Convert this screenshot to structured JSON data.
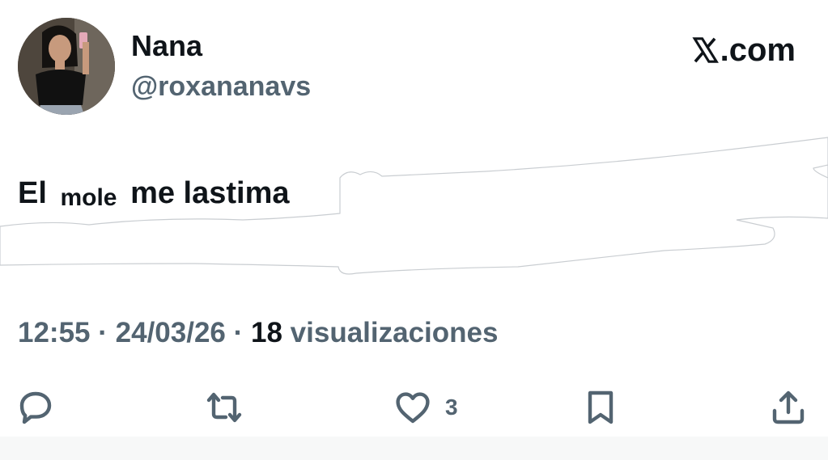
{
  "user": {
    "name": "Nana",
    "handle": "@roxananavs"
  },
  "brand": {
    "logo_icon": "x-logo-icon",
    "label": ".com"
  },
  "tweet": {
    "part1": "El",
    "part2": "mole",
    "part3": "me lastima"
  },
  "meta": {
    "time": "12:55",
    "sep1": " · ",
    "date": "24/03/26",
    "sep2": " · ",
    "views_count": "18",
    "views_label": " visualizaciones"
  },
  "actions": {
    "reply_icon": "reply-icon",
    "retweet_icon": "retweet-icon",
    "like_icon": "heart-icon",
    "like_count": "3",
    "bookmark_icon": "bookmark-icon",
    "share_icon": "share-icon"
  },
  "colors": {
    "text_primary": "#0f1419",
    "text_secondary": "#536471",
    "background": "#ffffff"
  }
}
